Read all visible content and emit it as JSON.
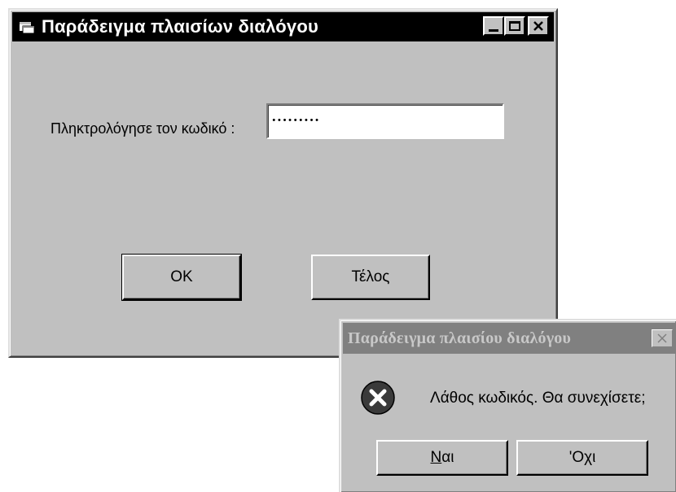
{
  "main_window": {
    "title": "Παράδειγμα πλαισίων διαλόγου",
    "code_label": "Πληκτρολόγησε τον κωδικό :",
    "code_value": "*********",
    "ok_label": "OK",
    "end_label": "Τέλος"
  },
  "message_box": {
    "title": "Παράδειγμα πλαισίου διαλόγου",
    "message": "Λάθος κωδικός. Θα συνεχίσετε;",
    "yes_first": "Ν",
    "yes_rest": "αι",
    "no_first": "'Ο",
    "no_mid": "χ",
    "no_rest": "ι",
    "icon": "error-icon"
  },
  "colors": {
    "face": "#c0c0c0",
    "active_title": "#000000",
    "inactive_title": "#808080",
    "error_icon": "#404040"
  }
}
